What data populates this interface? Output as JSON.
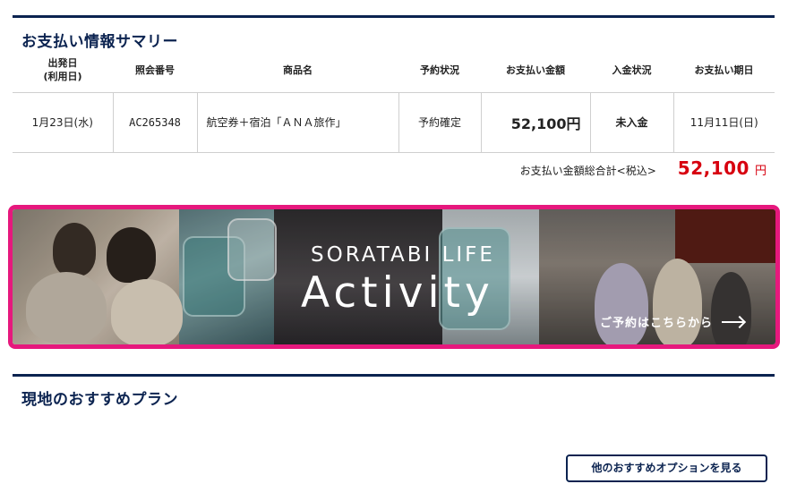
{
  "payment_summary": {
    "title": "お支払い情報サマリー",
    "columns": [
      "出発日\n(利用日)",
      "照会番号",
      "商品名",
      "予約状況",
      "お支払い金額",
      "入金状況",
      "お支払い期日"
    ],
    "rows": [
      {
        "departure": "1月23日(水)",
        "reference": "AC265348",
        "product": "航空券＋宿泊「ＡＮＡ旅作」",
        "reservation_status": "予約確定",
        "amount": "52,100円",
        "deposit_status": "未入金",
        "due_date": "11月11日(日)"
      }
    ],
    "total_label": "お支払い金額総合計<税込>",
    "total_amount": "52,100",
    "total_unit": "円"
  },
  "banner": {
    "subtitle": "SORATABI LIFE",
    "title": "Activity",
    "cta": "ご予約はこちらから",
    "cta_icon": "arrow-right-icon",
    "border_color": "#e6187d"
  },
  "recommend": {
    "title": "現地のおすすめプラン",
    "button_label": "他のおすすめオプションを見る"
  },
  "colors": {
    "navy": "#0b2350",
    "price_red": "#d7000f"
  }
}
